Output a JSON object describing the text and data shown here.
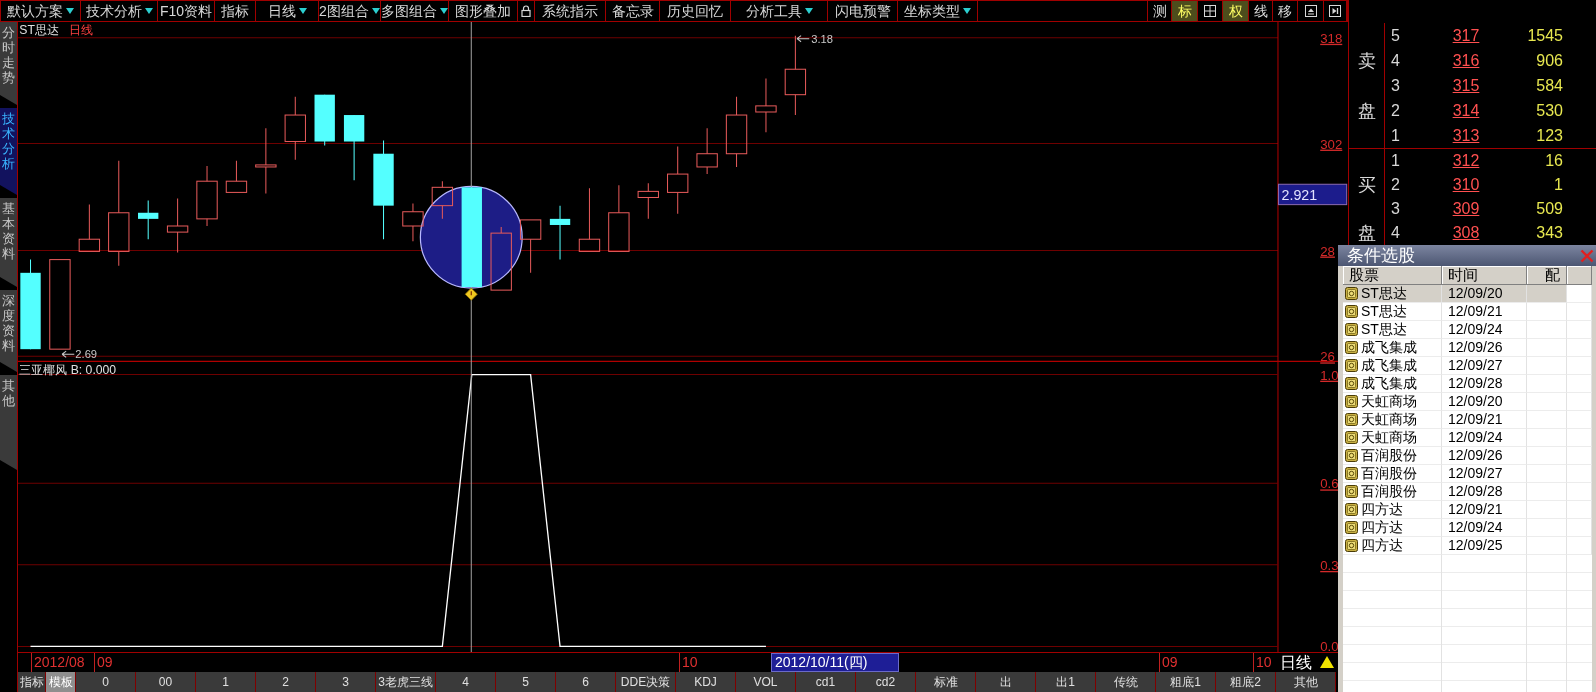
{
  "toolbar": {
    "menus": [
      {
        "kind": "menu",
        "label": "默认方案",
        "dropdown": true
      },
      {
        "kind": "menu",
        "label": "技术分析",
        "dropdown": true
      },
      {
        "kind": "menu",
        "label": "F10资料",
        "dropdown": false
      },
      {
        "kind": "menu",
        "label": "指标",
        "dropdown": false
      },
      {
        "kind": "menu",
        "label": "日线",
        "dropdown": true
      },
      {
        "kind": "menu",
        "label": "2图组合",
        "dropdown": true
      },
      {
        "kind": "menu",
        "label": "多图组合",
        "dropdown": true
      },
      {
        "kind": "menu",
        "label": "图形叠加",
        "dropdown": false
      },
      {
        "kind": "lock"
      },
      {
        "kind": "menu",
        "label": "系统指示",
        "dropdown": false
      },
      {
        "kind": "menu",
        "label": "备忘录",
        "dropdown": false
      },
      {
        "kind": "menu",
        "label": "历史回忆",
        "dropdown": false
      },
      {
        "kind": "menu",
        "label": "分析工具",
        "dropdown": true
      },
      {
        "kind": "menu",
        "label": "闪电预警",
        "dropdown": false
      },
      {
        "kind": "menu",
        "label": "坐标类型",
        "dropdown": true
      }
    ],
    "toggles": [
      {
        "kind": "text",
        "label": "测",
        "selected": false
      },
      {
        "kind": "text",
        "label": "标",
        "selected": true
      },
      {
        "kind": "grid",
        "selected": false
      },
      {
        "kind": "text",
        "label": "权",
        "selected": true
      },
      {
        "kind": "text",
        "label": "线",
        "selected": false
      },
      {
        "kind": "text",
        "label": "移",
        "selected": false
      },
      {
        "kind": "eject",
        "selected": false
      },
      {
        "kind": "skip",
        "selected": false
      }
    ]
  },
  "left_tabs": [
    {
      "label": "分时走势",
      "selected": false
    },
    {
      "label": "技术分析",
      "selected": true
    },
    {
      "label": "基本资料",
      "selected": false
    },
    {
      "label": "深度资料",
      "selected": false
    },
    {
      "label": "其他",
      "selected": false
    }
  ],
  "price_chart": {
    "symbol": "ST思达",
    "period": "日线",
    "high_price": "3.18",
    "low_price": "2.69",
    "axis_labels": [
      "318",
      "302",
      "28",
      "26"
    ],
    "cursor_price": "2.921"
  },
  "indicator": {
    "title": "三亚椰风 B: 0.000",
    "chart_data": {
      "type": "line",
      "ylim": [
        0,
        1
      ],
      "yticks": [
        {
          "value": 0,
          "label": "0.0"
        },
        {
          "value": 0.3,
          "label": "0.3"
        },
        {
          "value": 0.6,
          "label": "0.6"
        },
        {
          "value": 1,
          "label": "1.0"
        }
      ],
      "series": [
        {
          "color": "#ffffff",
          "values": [
            0,
            0,
            0,
            0,
            0,
            0,
            0,
            0,
            0,
            0,
            0,
            0,
            0,
            0,
            0,
            1,
            1,
            1,
            0,
            0,
            0,
            0,
            0,
            0,
            0,
            0
          ]
        }
      ]
    }
  },
  "date_axis": {
    "ticks": [
      "2012/08",
      "09",
      "10",
      "09",
      "10"
    ],
    "cursor_date": "2012/10/11(四)",
    "period": "日线"
  },
  "bottom_tabs": [
    {
      "label": "指标",
      "selected": false
    },
    {
      "label": "模板",
      "selected": true
    },
    {
      "label": "0",
      "selected": false
    },
    {
      "label": "00",
      "selected": false
    },
    {
      "label": "1",
      "selected": false
    },
    {
      "label": "2",
      "selected": false
    },
    {
      "label": "3",
      "selected": false
    },
    {
      "label": "3老虎三线",
      "selected": false
    },
    {
      "label": "4",
      "selected": false
    },
    {
      "label": "5",
      "selected": false
    },
    {
      "label": "6",
      "selected": false
    },
    {
      "label": "DDE决策",
      "selected": false
    },
    {
      "label": "KDJ",
      "selected": false
    },
    {
      "label": "VOL",
      "selected": false
    },
    {
      "label": "cd1",
      "selected": false
    },
    {
      "label": "cd2",
      "selected": false
    },
    {
      "label": "标准",
      "selected": false
    },
    {
      "label": "出",
      "selected": false
    },
    {
      "label": "出1",
      "selected": false
    },
    {
      "label": "传统",
      "selected": false
    },
    {
      "label": "粗底1",
      "selected": false
    },
    {
      "label": "粗底2",
      "selected": false
    },
    {
      "label": "其他",
      "selected": false
    }
  ],
  "order_book": {
    "sections": [
      {
        "kind": "sell",
        "label_chars": [
          "卖",
          "盘"
        ],
        "rows": [
          {
            "rank": "5",
            "price": "317",
            "volume": "1545"
          },
          {
            "rank": "4",
            "price": "316",
            "volume": "906"
          },
          {
            "rank": "3",
            "price": "315",
            "volume": "584"
          },
          {
            "rank": "2",
            "price": "314",
            "volume": "530"
          },
          {
            "rank": "1",
            "price": "313",
            "volume": "123"
          }
        ]
      },
      {
        "kind": "buy",
        "label_chars": [
          "买",
          "盘"
        ],
        "rows": [
          {
            "rank": "1",
            "price": "312",
            "volume": "16"
          },
          {
            "rank": "2",
            "price": "310",
            "volume": "1"
          },
          {
            "rank": "3",
            "price": "309",
            "volume": "509"
          },
          {
            "rank": "4",
            "price": "308",
            "volume": "343"
          }
        ]
      }
    ]
  },
  "stock_picker": {
    "title": "条件选股",
    "columns": [
      "股票",
      "时间",
      "配"
    ],
    "rows": [
      {
        "name": "ST思达",
        "date": "12/09/20",
        "selected": true
      },
      {
        "name": "ST思达",
        "date": "12/09/21",
        "selected": false
      },
      {
        "name": "ST思达",
        "date": "12/09/24",
        "selected": false
      },
      {
        "name": "成飞集成",
        "date": "12/09/26",
        "selected": false
      },
      {
        "name": "成飞集成",
        "date": "12/09/27",
        "selected": false
      },
      {
        "name": "成飞集成",
        "date": "12/09/28",
        "selected": false
      },
      {
        "name": "天虹商场",
        "date": "12/09/20",
        "selected": false
      },
      {
        "name": "天虹商场",
        "date": "12/09/21",
        "selected": false
      },
      {
        "name": "天虹商场",
        "date": "12/09/24",
        "selected": false
      },
      {
        "name": "百润股份",
        "date": "12/09/26",
        "selected": false
      },
      {
        "name": "百润股份",
        "date": "12/09/27",
        "selected": false
      },
      {
        "name": "百润股份",
        "date": "12/09/28",
        "selected": false
      },
      {
        "name": "四方达",
        "date": "12/09/21",
        "selected": false
      },
      {
        "name": "四方达",
        "date": "12/09/24",
        "selected": false
      },
      {
        "name": "四方达",
        "date": "12/09/25",
        "selected": false
      }
    ]
  }
}
